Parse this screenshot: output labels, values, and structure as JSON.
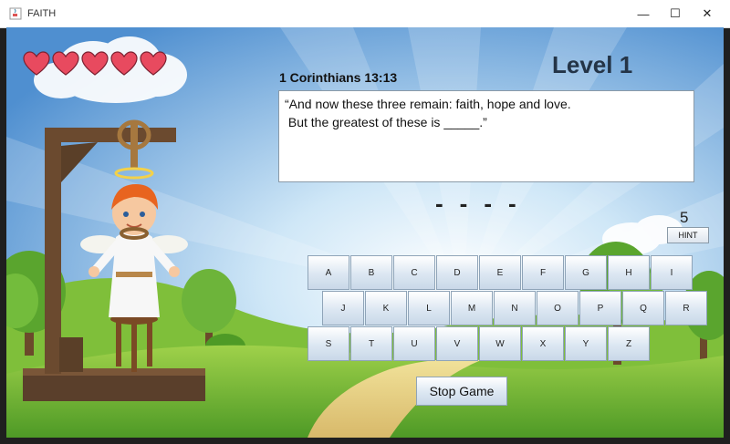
{
  "window": {
    "title": "FAITH"
  },
  "hearts": {
    "count": 5,
    "color": "#e84a5f"
  },
  "level": {
    "label": "Level 1"
  },
  "verse": {
    "reference": "1 Corinthians 13:13",
    "text": "“And now these three remain: faith, hope and love.\n But the greatest of these is _____.”"
  },
  "word_blanks": [
    "-",
    "-",
    "-",
    "-"
  ],
  "hint": {
    "count": "5",
    "label": "HINT"
  },
  "keyboard": {
    "row1": [
      "A",
      "B",
      "C",
      "D",
      "E",
      "F",
      "G",
      "H",
      "I"
    ],
    "row2": [
      "J",
      "K",
      "L",
      "M",
      "N",
      "O",
      "P",
      "Q",
      "R"
    ],
    "row3": [
      "S",
      "T",
      "U",
      "V",
      "W",
      "X",
      "Y",
      "Z"
    ]
  },
  "stop_button": {
    "label": "Stop Game"
  },
  "icons": {
    "app": "java-cup-icon",
    "minimize": "minimize-icon",
    "maximize": "maximize-icon",
    "close": "close-icon"
  }
}
